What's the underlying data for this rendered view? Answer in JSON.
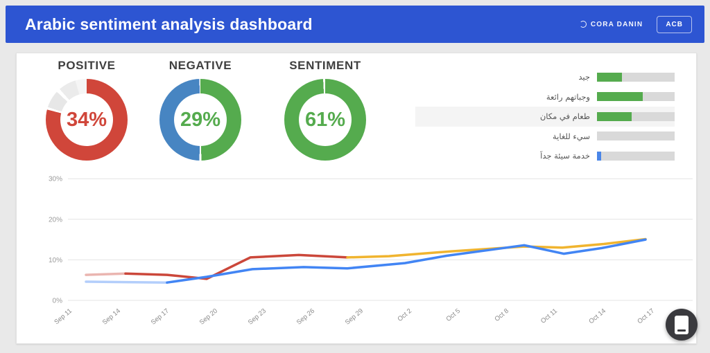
{
  "header": {
    "title": "Arabic sentiment analysis dashboard",
    "action_label": "CORA DANIN",
    "lang_button": "ACB"
  },
  "colors": {
    "header_blue": "#2d55d2",
    "positive_red": "#d0463a",
    "negative_blue": "#4785c2",
    "green": "#55ab4e",
    "line_red": "#cb473a",
    "line_blue": "#4285f4",
    "line_yellow": "#f0b42f",
    "bar_track": "#d9d9d9"
  },
  "chart_data": [
    {
      "type": "pie",
      "variant": "donut",
      "items": [
        {
          "label": "POSITIVE",
          "value": "34%",
          "value_color": "#d0463a",
          "segments": [
            [
              "#d0463a",
              0,
              79
            ],
            [
              "#ffffff",
              79,
              80
            ],
            [
              "#e7e7e7",
              80,
              87
            ],
            [
              "#ffffff",
              87,
              88.5
            ],
            [
              "#ebebeb",
              88.5,
              95.5
            ],
            [
              "#f5f5f5",
              95.5,
              100
            ]
          ]
        },
        {
          "label": "NEGATIVE",
          "value": "29%",
          "value_color": "#55ab4e",
          "segments": [
            [
              "#55ab4e",
              0,
              49.6
            ],
            [
              "#ffffff",
              49.6,
              50.4
            ],
            [
              "#4785c2",
              50.4,
              99.6
            ],
            [
              "#ffffff",
              99.6,
              100
            ]
          ]
        },
        {
          "label": "SENTIMENT",
          "value": "61%",
          "value_color": "#55ab4e",
          "segments": [
            [
              "#55ab4e",
              0,
              99.2
            ],
            [
              "#ffffff",
              99.2,
              100
            ]
          ]
        }
      ]
    },
    {
      "type": "bar",
      "orientation": "horizontal",
      "track_color": "#d9d9d9",
      "rows": [
        {
          "label": "جيد",
          "value_pct": 32,
          "color": "#55ab4e",
          "highlighted": false
        },
        {
          "label": "وجباتهم رائعة",
          "value_pct": 59,
          "color": "#55ab4e",
          "highlighted": false
        },
        {
          "label": "طعام في مكان",
          "value_pct": 45,
          "color": "#55ab4e",
          "highlighted": true
        },
        {
          "label": "سيء للغاية",
          "value_pct": 0,
          "color": null,
          "highlighted": false
        },
        {
          "label": "خدمة سيئة جداً",
          "value_pct": 5,
          "color": "#4a86e8",
          "highlighted": false
        }
      ]
    },
    {
      "type": "line",
      "ylim": [
        0,
        30
      ],
      "grid": true,
      "yticks": [
        {
          "label": "0%",
          "v": 0
        },
        {
          "label": "10%",
          "v": 10
        },
        {
          "label": "20%",
          "v": 20
        },
        {
          "label": "30%",
          "v": 30
        }
      ],
      "x_labels": [
        "Sep 11",
        "Sep 14",
        "Sep 17",
        "Sep 20",
        "Sep 23",
        "Sep 26",
        "Sep 29",
        "Oct 2",
        "Oct 5",
        "Oct 8",
        "Oct 11",
        "Oct 14",
        "Oct 17"
      ],
      "series": [
        {
          "name": "trend-red",
          "color": "#cb473a",
          "fade_points": 1,
          "points": [
            [
              100,
              6.3
            ],
            [
              157,
              6.6
            ],
            [
              217,
              6.3
            ],
            [
              274,
              5.3
            ],
            [
              337,
              10.6
            ],
            [
              407,
              11.2
            ],
            [
              477,
              10.6
            ]
          ]
        },
        {
          "name": "trend-yellow",
          "color": "#f0b42f",
          "fade_points": 0,
          "points": [
            [
              477,
              10.6
            ],
            [
              537,
              10.9
            ],
            [
              627,
              12.1
            ],
            [
              732,
              13.3
            ],
            [
              787,
              13.0
            ],
            [
              847,
              13.9
            ],
            [
              907,
              15.1
            ]
          ]
        },
        {
          "name": "trend-blue",
          "color": "#4285f4",
          "fade_points": 2,
          "points": [
            [
              100,
              4.6
            ],
            [
              157,
              4.5
            ],
            [
              217,
              4.4
            ],
            [
              274,
              5.8
            ],
            [
              340,
              7.7
            ],
            [
              414,
              8.2
            ],
            [
              477,
              7.9
            ],
            [
              560,
              9.2
            ],
            [
              620,
              11.0
            ],
            [
              732,
              13.6
            ],
            [
              789,
              11.5
            ],
            [
              844,
              12.9
            ],
            [
              907,
              15.0
            ]
          ]
        }
      ]
    }
  ]
}
